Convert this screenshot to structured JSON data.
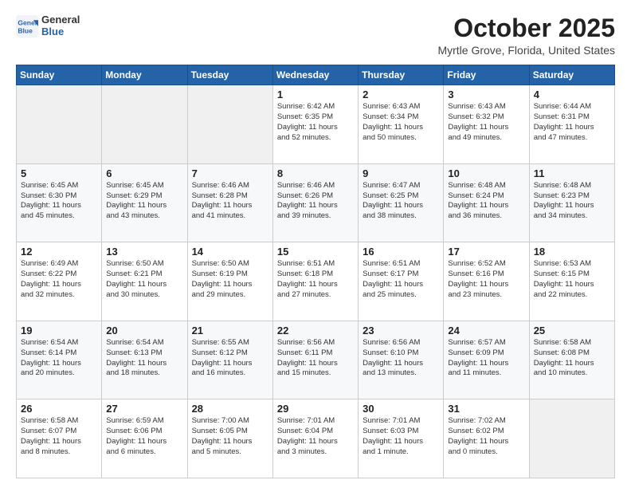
{
  "logo": {
    "line1": "General",
    "line2": "Blue"
  },
  "header": {
    "title": "October 2025",
    "subtitle": "Myrtle Grove, Florida, United States"
  },
  "days_of_week": [
    "Sunday",
    "Monday",
    "Tuesday",
    "Wednesday",
    "Thursday",
    "Friday",
    "Saturday"
  ],
  "weeks": [
    [
      {
        "day": "",
        "detail": ""
      },
      {
        "day": "",
        "detail": ""
      },
      {
        "day": "",
        "detail": ""
      },
      {
        "day": "1",
        "detail": "Sunrise: 6:42 AM\nSunset: 6:35 PM\nDaylight: 11 hours\nand 52 minutes."
      },
      {
        "day": "2",
        "detail": "Sunrise: 6:43 AM\nSunset: 6:34 PM\nDaylight: 11 hours\nand 50 minutes."
      },
      {
        "day": "3",
        "detail": "Sunrise: 6:43 AM\nSunset: 6:32 PM\nDaylight: 11 hours\nand 49 minutes."
      },
      {
        "day": "4",
        "detail": "Sunrise: 6:44 AM\nSunset: 6:31 PM\nDaylight: 11 hours\nand 47 minutes."
      }
    ],
    [
      {
        "day": "5",
        "detail": "Sunrise: 6:45 AM\nSunset: 6:30 PM\nDaylight: 11 hours\nand 45 minutes."
      },
      {
        "day": "6",
        "detail": "Sunrise: 6:45 AM\nSunset: 6:29 PM\nDaylight: 11 hours\nand 43 minutes."
      },
      {
        "day": "7",
        "detail": "Sunrise: 6:46 AM\nSunset: 6:28 PM\nDaylight: 11 hours\nand 41 minutes."
      },
      {
        "day": "8",
        "detail": "Sunrise: 6:46 AM\nSunset: 6:26 PM\nDaylight: 11 hours\nand 39 minutes."
      },
      {
        "day": "9",
        "detail": "Sunrise: 6:47 AM\nSunset: 6:25 PM\nDaylight: 11 hours\nand 38 minutes."
      },
      {
        "day": "10",
        "detail": "Sunrise: 6:48 AM\nSunset: 6:24 PM\nDaylight: 11 hours\nand 36 minutes."
      },
      {
        "day": "11",
        "detail": "Sunrise: 6:48 AM\nSunset: 6:23 PM\nDaylight: 11 hours\nand 34 minutes."
      }
    ],
    [
      {
        "day": "12",
        "detail": "Sunrise: 6:49 AM\nSunset: 6:22 PM\nDaylight: 11 hours\nand 32 minutes."
      },
      {
        "day": "13",
        "detail": "Sunrise: 6:50 AM\nSunset: 6:21 PM\nDaylight: 11 hours\nand 30 minutes."
      },
      {
        "day": "14",
        "detail": "Sunrise: 6:50 AM\nSunset: 6:19 PM\nDaylight: 11 hours\nand 29 minutes."
      },
      {
        "day": "15",
        "detail": "Sunrise: 6:51 AM\nSunset: 6:18 PM\nDaylight: 11 hours\nand 27 minutes."
      },
      {
        "day": "16",
        "detail": "Sunrise: 6:51 AM\nSunset: 6:17 PM\nDaylight: 11 hours\nand 25 minutes."
      },
      {
        "day": "17",
        "detail": "Sunrise: 6:52 AM\nSunset: 6:16 PM\nDaylight: 11 hours\nand 23 minutes."
      },
      {
        "day": "18",
        "detail": "Sunrise: 6:53 AM\nSunset: 6:15 PM\nDaylight: 11 hours\nand 22 minutes."
      }
    ],
    [
      {
        "day": "19",
        "detail": "Sunrise: 6:54 AM\nSunset: 6:14 PM\nDaylight: 11 hours\nand 20 minutes."
      },
      {
        "day": "20",
        "detail": "Sunrise: 6:54 AM\nSunset: 6:13 PM\nDaylight: 11 hours\nand 18 minutes."
      },
      {
        "day": "21",
        "detail": "Sunrise: 6:55 AM\nSunset: 6:12 PM\nDaylight: 11 hours\nand 16 minutes."
      },
      {
        "day": "22",
        "detail": "Sunrise: 6:56 AM\nSunset: 6:11 PM\nDaylight: 11 hours\nand 15 minutes."
      },
      {
        "day": "23",
        "detail": "Sunrise: 6:56 AM\nSunset: 6:10 PM\nDaylight: 11 hours\nand 13 minutes."
      },
      {
        "day": "24",
        "detail": "Sunrise: 6:57 AM\nSunset: 6:09 PM\nDaylight: 11 hours\nand 11 minutes."
      },
      {
        "day": "25",
        "detail": "Sunrise: 6:58 AM\nSunset: 6:08 PM\nDaylight: 11 hours\nand 10 minutes."
      }
    ],
    [
      {
        "day": "26",
        "detail": "Sunrise: 6:58 AM\nSunset: 6:07 PM\nDaylight: 11 hours\nand 8 minutes."
      },
      {
        "day": "27",
        "detail": "Sunrise: 6:59 AM\nSunset: 6:06 PM\nDaylight: 11 hours\nand 6 minutes."
      },
      {
        "day": "28",
        "detail": "Sunrise: 7:00 AM\nSunset: 6:05 PM\nDaylight: 11 hours\nand 5 minutes."
      },
      {
        "day": "29",
        "detail": "Sunrise: 7:01 AM\nSunset: 6:04 PM\nDaylight: 11 hours\nand 3 minutes."
      },
      {
        "day": "30",
        "detail": "Sunrise: 7:01 AM\nSunset: 6:03 PM\nDaylight: 11 hours\nand 1 minute."
      },
      {
        "day": "31",
        "detail": "Sunrise: 7:02 AM\nSunset: 6:02 PM\nDaylight: 11 hours\nand 0 minutes."
      },
      {
        "day": "",
        "detail": ""
      }
    ]
  ]
}
